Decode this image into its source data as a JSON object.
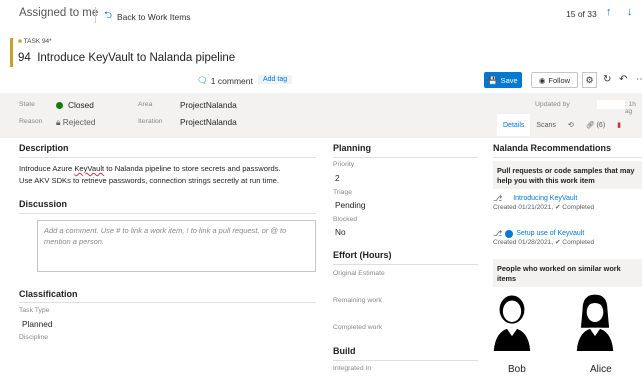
{
  "header": {
    "view_title": "Assigned to me",
    "back_label": "Back to Work Items",
    "counter": "15 of 33"
  },
  "work_item": {
    "type_tag": "TASK 94*",
    "id": "94",
    "title": "Introduce KeyVault to Nalanda pipeline",
    "comment_count": "1 comment",
    "add_tag_label": "Add tag"
  },
  "toolbar": {
    "save_label": "Save",
    "follow_label": "Follow"
  },
  "fields": {
    "state_label": "State",
    "state_value": "Closed",
    "reason_label": "Reason",
    "reason_value": "Rejected",
    "area_label": "Area",
    "area_value": "ProjectNalanda",
    "iteration_label": "Iteration",
    "iteration_value": "ProjectNalanda",
    "updated_label": "Updated by",
    "updated_time": ": 1h ag"
  },
  "tabs": [
    {
      "label": "Details"
    },
    {
      "label": "Scans"
    },
    {
      "label": ""
    },
    {
      "label": "(6)"
    },
    {
      "label": ""
    }
  ],
  "description": {
    "title": "Description",
    "text_1a": "Introduce Azure ",
    "text_1b": "KeyVault",
    "text_1c": " to Nalanda pipeline to store secrets and passwords.",
    "text_2": "Use AKV SDKs to retrieve passwords, connection strings secretly at run time."
  },
  "discussion": {
    "title": "Discussion",
    "placeholder": "Add a comment. Use # to link a work item, ! to link a pull request, or @ to mention a person."
  },
  "classification": {
    "title": "Classification",
    "task_type_label": "Task Type",
    "task_type_value": "Planned",
    "discipline_label": "Discipline"
  },
  "planning": {
    "title": "Planning",
    "priority_label": "Priority",
    "priority_value": "2",
    "triage_label": "Triage",
    "triage_value": "Pending",
    "blocked_label": "Blocked",
    "blocked_value": "No"
  },
  "effort": {
    "title": "Effort (Hours)",
    "original_label": "Original Estimate",
    "remaining_label": "Remaining work",
    "completed_label": "Completed work"
  },
  "build": {
    "title": "Build",
    "integrated_label": "Integrated In"
  },
  "recommendations": {
    "title": "Nalanda Recommendations",
    "pr_header": "Pull requests or code samples that may help you with this work item",
    "items": [
      {
        "link": "Introducing KeyVault",
        "meta": "Created 01/21/2021, ✔ Completed"
      },
      {
        "link": "Setup use of Keyvault",
        "meta": "Created 01/28/2021, ✔ Completed"
      }
    ],
    "people_header": "People who worked on similar work items",
    "people": [
      {
        "name": "Bob"
      },
      {
        "name": "Alice"
      }
    ]
  },
  "colors": {
    "accent": "#0078d4",
    "closed": "#107c10",
    "task": "#c9a227"
  }
}
